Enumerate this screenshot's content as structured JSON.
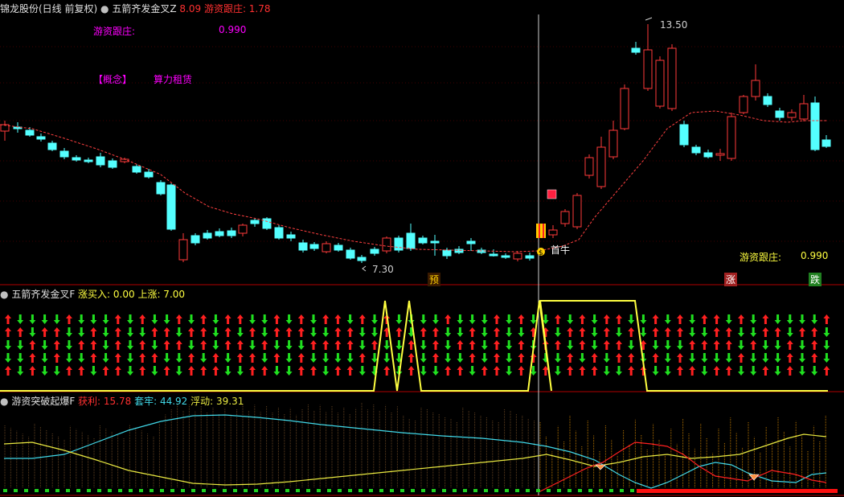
{
  "panel1": {
    "stock_name": "锦龙股份(日线 前复权)",
    "indicator": "五箭齐发金叉Z",
    "value1": "8.09",
    "value2_label": "游资跟庄: 1.78",
    "youzi_label": "游资跟庄:",
    "youzi_value": "0.990",
    "concept_label": "【概念】",
    "concept_value": "算力租赁",
    "high_label": "13.50",
    "low_label": "7.30",
    "first_board": "首牛",
    "bottom_right_label": "游资跟庄:",
    "bottom_right_value": "0.990",
    "tag_yu": "预",
    "tag_zhang": "涨",
    "tag_die": "跌",
    "colors": {
      "up": "#ff3a3a",
      "down": "#54ffff",
      "ma": "#ff4040",
      "label": "#ff00ff"
    }
  },
  "panel2": {
    "title": "五箭齐发金叉F",
    "label_buy": "涨买入: 0.00",
    "label_up": "上涨: 7.00",
    "arrows": "RGRGGRGRGGRRGGGRRGGRRGGGGGRRRGGGRRRRGGGGGRRRGGRRRGGGRRRRRRGGGRRGGGRRRGGRRRGGRRRRGRGGGGGRRRGRR",
    "colors": {
      "up": "#ff2020",
      "down": "#20e020",
      "signal": "#ffff40"
    }
  },
  "panel3": {
    "title": "游资突破起爆F",
    "profit_label": "获利: 15.78",
    "trap_label": "套牢: 44.92",
    "float_label": "浮动: 39.31",
    "colors": {
      "cyan": "#40d8e8",
      "yellow": "#e8e840",
      "red": "#ff2020"
    }
  }
}
